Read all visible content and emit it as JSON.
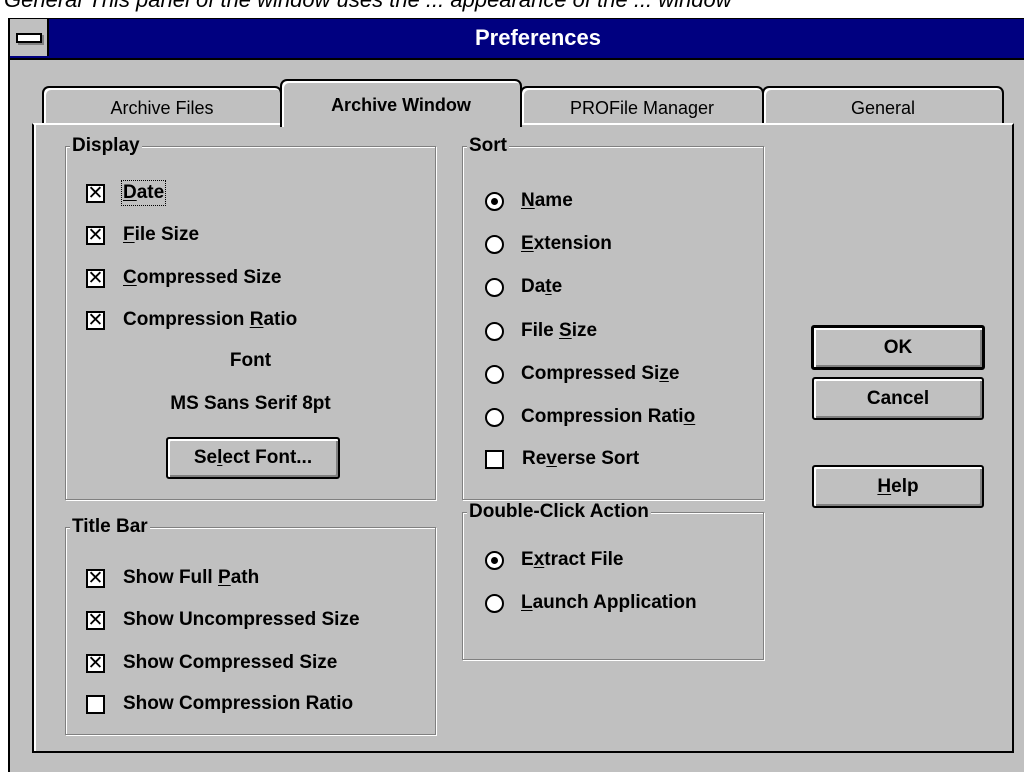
{
  "top_fragment": "General This panel of the window uses the ... appearance of the ... window",
  "window": {
    "title": "Preferences"
  },
  "tabs": [
    {
      "label": "Archive Files",
      "active": false
    },
    {
      "label": "Archive Window",
      "active": true
    },
    {
      "label": "PROFile Manager",
      "active": false
    },
    {
      "label": "General",
      "active": false
    }
  ],
  "display": {
    "title": "Display",
    "date": {
      "pre": "",
      "ul": "D",
      "post": "ate",
      "checked": true
    },
    "file_size": {
      "pre": "",
      "ul": "F",
      "post": "ile Size",
      "checked": true
    },
    "compressed_size": {
      "pre": "",
      "ul": "C",
      "post": "ompressed Size",
      "checked": true
    },
    "compression_ratio": {
      "pre": "Compression ",
      "ul": "R",
      "post": "atio",
      "checked": true
    },
    "font_label": "Font",
    "font_value": "MS Sans Serif 8pt",
    "select_font": {
      "pre": "Se",
      "ul": "l",
      "post": "ect Font..."
    }
  },
  "sort": {
    "title": "Sort",
    "name": {
      "pre": "",
      "ul": "N",
      "post": "ame",
      "selected": true
    },
    "extension": {
      "pre": "",
      "ul": "E",
      "post": "xtension",
      "selected": false
    },
    "date": {
      "pre": "Da",
      "ul": "t",
      "post": "e",
      "selected": false
    },
    "file_size": {
      "pre": "File ",
      "ul": "S",
      "post": "ize",
      "selected": false
    },
    "compressed_size": {
      "pre": "Compressed Si",
      "ul": "z",
      "post": "e",
      "selected": false
    },
    "compression_ratio": {
      "pre": "Compression Rati",
      "ul": "o",
      "post": "",
      "selected": false
    },
    "reverse": {
      "pre": "Re",
      "ul": "v",
      "post": "erse Sort",
      "checked": false
    }
  },
  "title_bar_group": {
    "title": "Title Bar",
    "full_path": {
      "pre": "Show Full ",
      "ul": "P",
      "post": "ath",
      "checked": true
    },
    "uncompressed_size": {
      "label": "Show Uncompressed Size",
      "checked": true
    },
    "compressed_size": {
      "label": "Show Compressed Size",
      "checked": true
    },
    "compression_ratio": {
      "label": "Show Compression Ratio",
      "checked": false
    }
  },
  "double_click": {
    "title": "Double-Click Action",
    "extract": {
      "pre": "E",
      "ul": "x",
      "post": "tract File",
      "selected": true
    },
    "launch": {
      "pre": "",
      "ul": "L",
      "post": "aunch Application",
      "selected": false
    }
  },
  "buttons": {
    "ok": "OK",
    "cancel": "Cancel",
    "help": {
      "pre": "",
      "ul": "H",
      "post": "elp"
    }
  }
}
